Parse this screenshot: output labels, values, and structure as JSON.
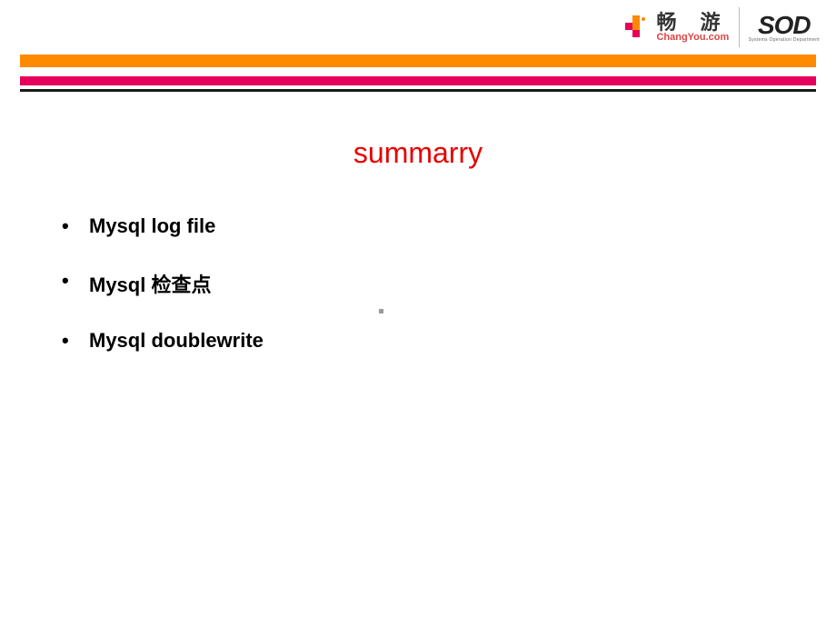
{
  "header": {
    "changyou": {
      "chinese": "畅 游",
      "domain": "ChangYou.com"
    },
    "sod": {
      "main": "SOD",
      "sub": "Systems Operation Department"
    }
  },
  "title": "summarry",
  "bullets": [
    "Mysql log file",
    "Mysql 检查点",
    "Mysql doublewrite"
  ]
}
